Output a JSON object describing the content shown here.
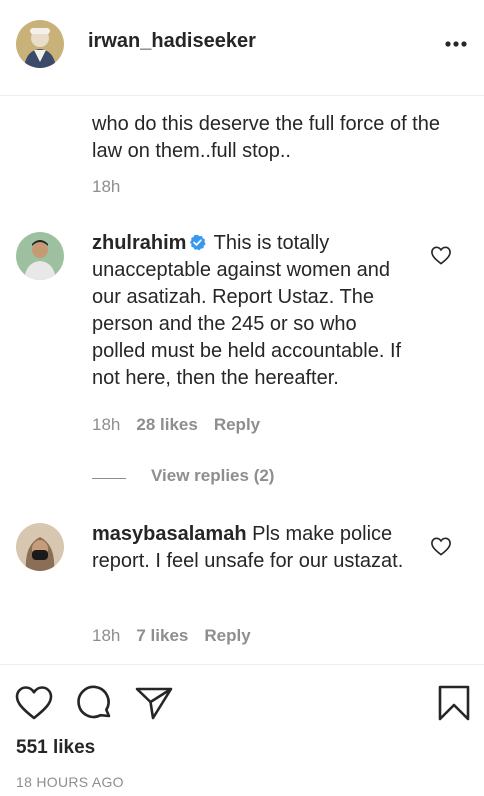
{
  "post": {
    "author_username": "irwan_hadiseeker",
    "more_icon": "more-horizontal-icon",
    "likes_text": "551 likes",
    "time_text": "18 HOURS AGO"
  },
  "comments": [
    {
      "text": "who do this deserve the full force of the law on them..full stop..",
      "time": "18h"
    },
    {
      "username": "zhulrahim",
      "verified": true,
      "text": "This is totally unacceptable against women and our asatizah. Report Ustaz. The person and the 245 or so who polled must be held accountable. If not here, then the hereafter.",
      "time": "18h",
      "likes": "28 likes",
      "reply_label": "Reply",
      "view_replies": "View replies (2)"
    },
    {
      "username": "masybasalamah",
      "text": "Pls make police report. I feel unsafe for our ustazat.",
      "time": "18h",
      "likes": "7 likes",
      "reply_label": "Reply"
    }
  ],
  "action_icons": [
    "heart-icon",
    "comment-icon",
    "share-icon",
    "bookmark-icon"
  ],
  "colors": {
    "text": "#262626",
    "secondary": "#8e8e8e",
    "verified": "#3897f0",
    "divider": "#efefef"
  }
}
